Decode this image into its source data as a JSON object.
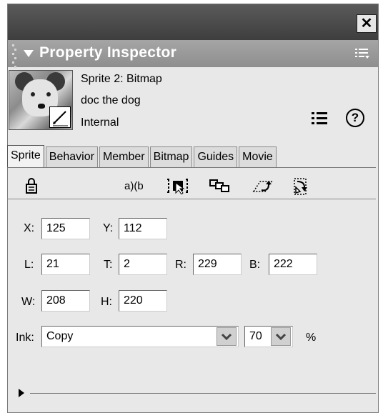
{
  "panel": {
    "close_glyph": "✕",
    "title": "Property Inspector"
  },
  "sprite_info": {
    "line1": "Sprite 2: Bitmap",
    "line2": "doc the dog",
    "line3": "Internal",
    "help_glyph": "?"
  },
  "tabs": [
    {
      "label": "Sprite",
      "active": true
    },
    {
      "label": "Behavior",
      "active": false
    },
    {
      "label": "Member",
      "active": false
    },
    {
      "label": "Bitmap",
      "active": false
    },
    {
      "label": "Guides",
      "active": false
    },
    {
      "label": "Movie",
      "active": false
    }
  ],
  "toolbar_icons": [
    "lock-icon",
    "name-label-icon",
    "edit-sprite-frames-icon",
    "tweening-icon",
    "rotate-icon",
    "flip-icon"
  ],
  "fields": {
    "x": {
      "label": "X:",
      "value": "125"
    },
    "y": {
      "label": "Y:",
      "value": "112"
    },
    "l": {
      "label": "L:",
      "value": "21"
    },
    "t": {
      "label": "T:",
      "value": "2"
    },
    "r": {
      "label": "R:",
      "value": "229"
    },
    "b": {
      "label": "B:",
      "value": "222"
    },
    "w": {
      "label": "W:",
      "value": "208"
    },
    "h": {
      "label": "H:",
      "value": "220"
    }
  },
  "ink": {
    "label": "Ink:",
    "value": "Copy",
    "blend_value": "70",
    "percent": "%"
  }
}
